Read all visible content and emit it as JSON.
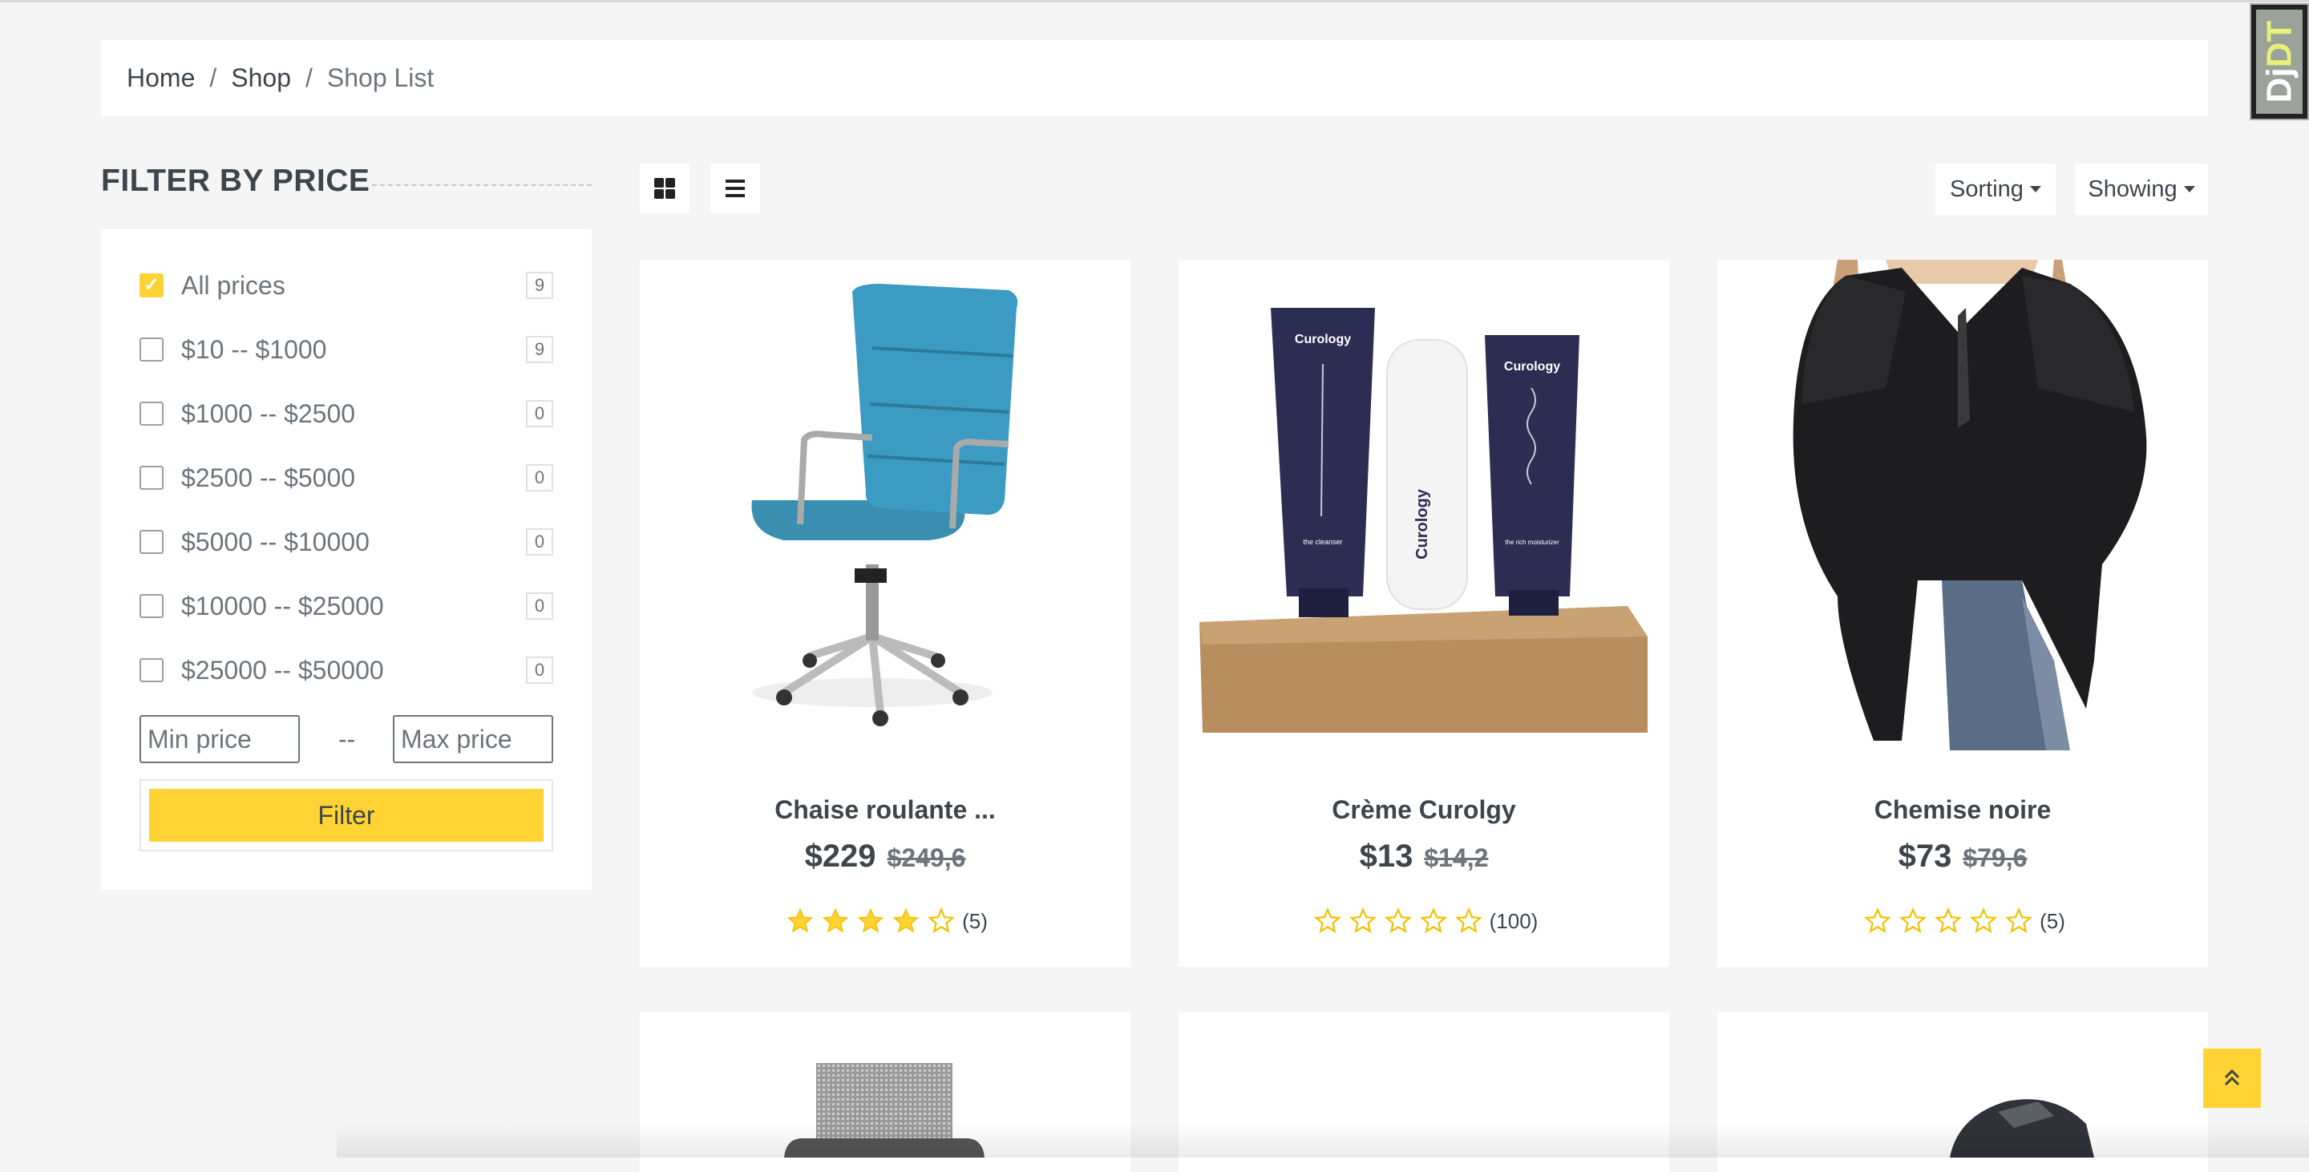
{
  "breadcrumb": {
    "home": "Home",
    "shop": "Shop",
    "current": "Shop List",
    "separator": "/"
  },
  "debug_toolbar": {
    "label_part1": "Dj",
    "label_part2": "DT"
  },
  "sidebar": {
    "title": "FILTER BY PRICE",
    "options": [
      {
        "label": "All prices",
        "count": "9",
        "checked": true
      },
      {
        "label": "$10 -- $1000",
        "count": "9",
        "checked": false
      },
      {
        "label": "$1000 -- $2500",
        "count": "0",
        "checked": false
      },
      {
        "label": "$2500 -- $5000",
        "count": "0",
        "checked": false
      },
      {
        "label": "$5000 -- $10000",
        "count": "0",
        "checked": false
      },
      {
        "label": "$10000 -- $25000",
        "count": "0",
        "checked": false
      },
      {
        "label": "$25000 -- $50000",
        "count": "0",
        "checked": false
      }
    ],
    "min_placeholder": "Min price",
    "max_placeholder": "Max price",
    "range_dash": "--",
    "filter_button": "Filter"
  },
  "toolbar": {
    "grid_icon": "grid-view-icon",
    "list_icon": "list-view-icon",
    "sorting_label": "Sorting",
    "showing_label": "Showing"
  },
  "products": [
    {
      "name": "Chaise roulante ...",
      "price": "$229",
      "old_price": "$249,6",
      "rating": 4,
      "reviews": "(5)",
      "image": "office-chair"
    },
    {
      "name": "Crème Curolgy",
      "price": "$13",
      "old_price": "$14,2",
      "rating": 0,
      "reviews": "(100)",
      "image": "skincare-tubes",
      "image_text": {
        "brand": "Curology",
        "tube1_sub": "the cleanser",
        "tube3_sub": "the rich moisturizer"
      }
    },
    {
      "name": "Chemise noire",
      "price": "$73",
      "old_price": "$79,6",
      "rating": 0,
      "reviews": "(5)",
      "image": "black-blouse"
    }
  ],
  "colors": {
    "accent": "#FFD333",
    "text": "#3D464D",
    "muted": "#6C757D",
    "background": "#F5F5F5"
  },
  "back_to_top_icon": "double-chevron-up-icon"
}
